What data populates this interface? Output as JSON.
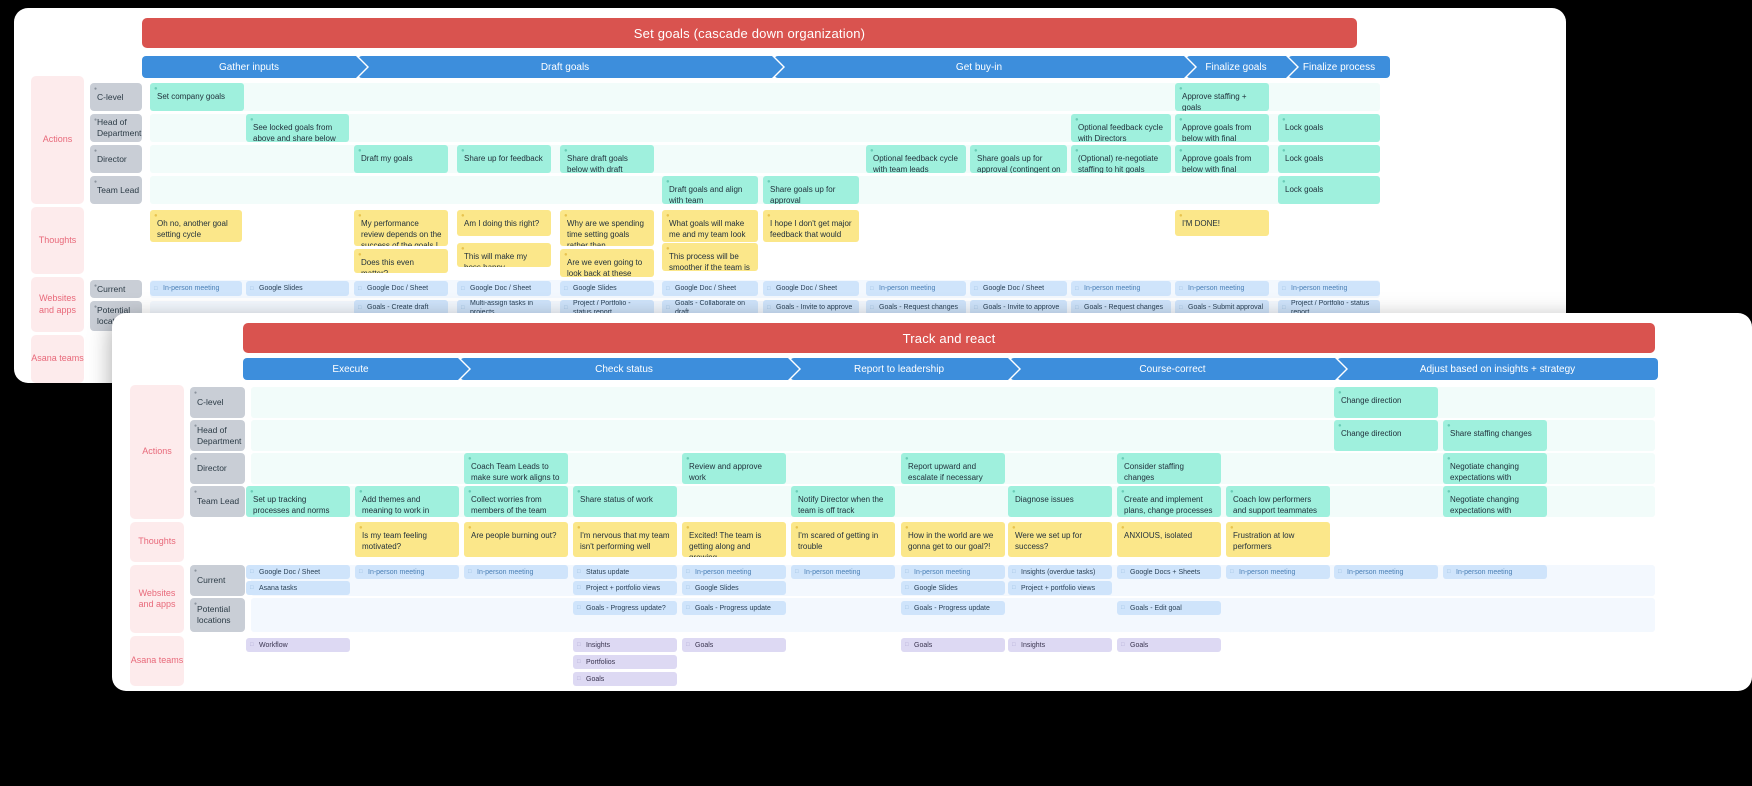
{
  "colors": {
    "title_bar": "#d9534f",
    "phase": "#3d8edc",
    "action_card": "#9ff0dd",
    "thought_card": "#fbe78a",
    "site_card": "#cfe4fb",
    "team_card": "#ddd9f3",
    "category_label": "#e8697a",
    "role_chip": "#c9ced6"
  },
  "board1": {
    "title": "Set goals (cascade down organization)",
    "phases": [
      {
        "label": "Gather inputs"
      },
      {
        "label": "Draft goals"
      },
      {
        "label": "Get buy-in"
      },
      {
        "label": "Finalize goals"
      },
      {
        "label": "Finalize process"
      }
    ],
    "categories": [
      {
        "label": "Actions"
      },
      {
        "label": "Thoughts"
      },
      {
        "label": "Websites and apps"
      },
      {
        "label": "Asana teams"
      }
    ],
    "roles": [
      {
        "label": "C-level"
      },
      {
        "label": "Head of Department"
      },
      {
        "label": "Director"
      },
      {
        "label": "Team Lead"
      },
      {
        "label": "Current"
      },
      {
        "label": "Potential locations"
      }
    ],
    "actions": {
      "c_level": [
        {
          "text": "Set company goals"
        },
        {
          "text": "Approve staffing + goals"
        }
      ],
      "head_of_department": [
        {
          "text": "See locked goals from above and share below"
        },
        {
          "text": "Optional feedback cycle with Directors"
        },
        {
          "text": "Approve goals from below with final staffing"
        },
        {
          "text": "Lock goals"
        }
      ],
      "director": [
        {
          "text": "Draft my goals"
        },
        {
          "text": "Share up for feedback"
        },
        {
          "text": "Share draft goals below with draft staffing of teams"
        },
        {
          "text": "Optional feedback cycle with team leads"
        },
        {
          "text": "Share goals up for approval (contingent on staffing)"
        },
        {
          "text": "(Optional) re-negotiate staffing to hit goals"
        },
        {
          "text": "Approve goals from below with final staffing"
        },
        {
          "text": "Lock goals"
        }
      ],
      "team_lead": [
        {
          "text": "Draft goals and align with team"
        },
        {
          "text": "Share goals up for approval"
        },
        {
          "text": "Lock goals"
        }
      ]
    },
    "thoughts": [
      {
        "text": "Oh no, another goal setting cycle"
      },
      {
        "text": "My performance review depends on the success of the goals I set"
      },
      {
        "text": "Am I doing this right?"
      },
      {
        "text": "Why are we spending time setting goals rather than implementing?"
      },
      {
        "text": "What goals will make me and my team look good?"
      },
      {
        "text": "I hope I don't get major feedback that would delay us"
      },
      {
        "text": "I'M DONE!"
      },
      {
        "text": "Does this even matter?"
      },
      {
        "text": "This will make my boss happy"
      },
      {
        "text": "Are we even going to look back at these goals?"
      },
      {
        "text": "This process will be smoother if the team is bought in"
      }
    ],
    "sites_current": [
      {
        "text": "In-person meeting",
        "link": true
      },
      {
        "text": "Google Slides"
      },
      {
        "text": "Google Doc / Sheet"
      },
      {
        "text": "Google Doc / Sheet"
      },
      {
        "text": "Google Slides"
      },
      {
        "text": "Google Doc / Sheet"
      },
      {
        "text": "Google Doc / Sheet"
      },
      {
        "text": "In-person meeting",
        "link": true
      },
      {
        "text": "Google Doc / Sheet"
      },
      {
        "text": "In-person meeting",
        "link": true
      },
      {
        "text": "In-person meeting",
        "link": true
      },
      {
        "text": "In-person meeting",
        "link": true
      }
    ],
    "sites_potential": [
      {
        "text": "Goals - Create draft"
      },
      {
        "text": "Multi-assign tasks in projects"
      },
      {
        "text": "Project / Portfolio - status report"
      },
      {
        "text": "Goals - Collaborate on draft"
      },
      {
        "text": "Goals - Invite to approve"
      },
      {
        "text": "Goals - Request changes"
      },
      {
        "text": "Goals - Invite to approve"
      },
      {
        "text": "Goals - Request changes"
      },
      {
        "text": "Goals - Submit approval"
      },
      {
        "text": "Project / Portfolio - status report"
      }
    ]
  },
  "board2": {
    "title": "Track and react",
    "phases": [
      {
        "label": "Execute"
      },
      {
        "label": "Check status"
      },
      {
        "label": "Report to leadership"
      },
      {
        "label": "Course-correct"
      },
      {
        "label": "Adjust based on insights + strategy"
      }
    ],
    "categories": [
      {
        "label": "Actions"
      },
      {
        "label": "Thoughts"
      },
      {
        "label": "Websites and apps"
      },
      {
        "label": "Asana teams"
      }
    ],
    "roles": [
      {
        "label": "C-level"
      },
      {
        "label": "Head of Department"
      },
      {
        "label": "Director"
      },
      {
        "label": "Team Lead"
      },
      {
        "label": "Current"
      },
      {
        "label": "Potential locations"
      }
    ],
    "actions": {
      "c_level": [
        {
          "text": "Change direction"
        }
      ],
      "head_of_department": [
        {
          "text": "Change direction"
        },
        {
          "text": "Share staffing changes"
        }
      ],
      "director": [
        {
          "text": "Coach Team Leads to make sure work aligns to goals"
        },
        {
          "text": "Review and approve work"
        },
        {
          "text": "Report upward and escalate if necessary"
        },
        {
          "text": "Consider staffing changes"
        },
        {
          "text": "Negotiate changing expectations with leadership"
        }
      ],
      "team_lead": [
        {
          "text": "Set up tracking processes and norms"
        },
        {
          "text": "Add themes and meaning to work in meetings"
        },
        {
          "text": "Collect worries from members of the team"
        },
        {
          "text": "Share status of work"
        },
        {
          "text": "Notify Director when the team is off track"
        },
        {
          "text": "Diagnose issues"
        },
        {
          "text": "Create and implement plans, change processes"
        },
        {
          "text": "Coach low performers and support teammates"
        },
        {
          "text": "Negotiate changing expectations with leadership"
        }
      ]
    },
    "thoughts": [
      {
        "text": "Is my team feeling motivated?"
      },
      {
        "text": "Are people burning out?"
      },
      {
        "text": "I'm nervous that my team isn't performing well"
      },
      {
        "text": "Excited! The team is getting along and growing"
      },
      {
        "text": "I'm scared of getting in trouble"
      },
      {
        "text": "How in the world are we gonna get to our goal?!"
      },
      {
        "text": "Were we set up for success?"
      },
      {
        "text": "ANXIOUS, isolated"
      },
      {
        "text": "Frustration at low performers"
      }
    ],
    "sites_current": [
      {
        "text": "Google Doc / Sheet"
      },
      {
        "text": "Asana tasks"
      },
      {
        "text": "In-person meeting",
        "link": true
      },
      {
        "text": "In-person meeting",
        "link": true
      },
      {
        "text": "Status update"
      },
      {
        "text": "Project + portfolio views"
      },
      {
        "text": "In-person meeting",
        "link": true
      },
      {
        "text": "Google Slides"
      },
      {
        "text": "In-person meeting",
        "link": true
      },
      {
        "text": "In-person meeting",
        "link": true
      },
      {
        "text": "Google Slides"
      },
      {
        "text": "Insights (overdue tasks)"
      },
      {
        "text": "Project + portfolio views"
      },
      {
        "text": "Google Docs + Sheets"
      },
      {
        "text": "In-person meeting",
        "link": true
      },
      {
        "text": "In-person meeting",
        "link": true
      },
      {
        "text": "In-person meeting",
        "link": true
      }
    ],
    "sites_potential": [
      {
        "text": "Goals - Progress update?"
      },
      {
        "text": "Goals - Progress update"
      },
      {
        "text": "Goals - Progress update"
      },
      {
        "text": "Goals - Edit goal"
      }
    ],
    "asana_teams": [
      {
        "text": "Workflow"
      },
      {
        "text": "Insights"
      },
      {
        "text": "Portfolios"
      },
      {
        "text": "Goals"
      },
      {
        "text": "Goals"
      },
      {
        "text": "Goals"
      },
      {
        "text": "Insights"
      },
      {
        "text": "Goals"
      }
    ]
  }
}
